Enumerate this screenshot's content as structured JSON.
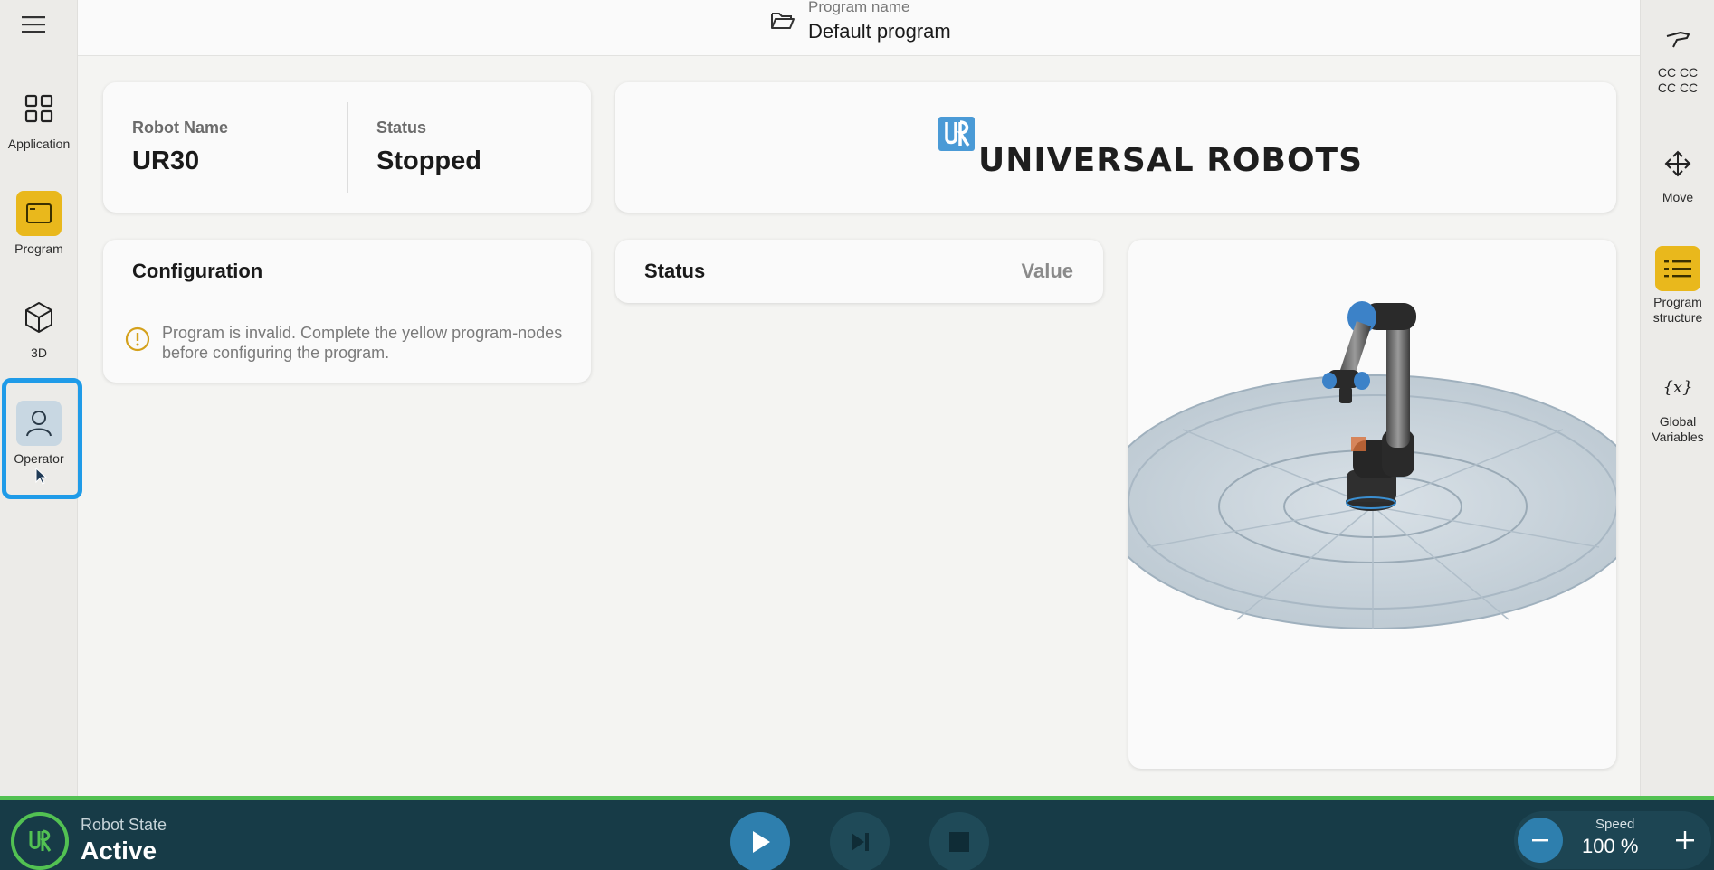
{
  "left_nav": {
    "items": [
      {
        "label": "Application",
        "icon": "grid-icon"
      },
      {
        "label": "Program",
        "icon": "program-window-icon"
      },
      {
        "label": "3D",
        "icon": "cube-icon"
      },
      {
        "label": "Operator",
        "icon": "person-icon"
      }
    ]
  },
  "right_nav": {
    "items": [
      {
        "label": "CC CC\nCC CC",
        "line1": "CC CC",
        "line2": "CC CC",
        "icon": "gripper-icon"
      },
      {
        "label": "Move",
        "line1": "Move",
        "line2": "",
        "icon": "move-arrows-icon"
      },
      {
        "label": "Program structure",
        "line1": "Program",
        "line2": "structure",
        "icon": "list-icon"
      },
      {
        "label": "Global Variables",
        "line1": "Global",
        "line2": "Variables",
        "icon": "variable-icon"
      }
    ]
  },
  "header": {
    "program_caption": "Program name",
    "program_value": "Default program"
  },
  "robot_info": {
    "name_label": "Robot Name",
    "name_value": "UR30",
    "status_label": "Status",
    "status_value": "Stopped"
  },
  "logo": {
    "text": "UNIVERSAL ROBOTS"
  },
  "configuration": {
    "title": "Configuration",
    "warning_line1": "Program is invalid. Complete the yellow program-nodes",
    "warning_line2": "before configuring the program."
  },
  "status_table": {
    "col_status": "Status",
    "col_value": "Value"
  },
  "bottom_bar": {
    "robot_state_caption": "Robot State",
    "robot_state_value": "Active",
    "speed_caption": "Speed",
    "speed_value": "100 %"
  },
  "colors": {
    "accent_yellow": "#e9b81c",
    "focus_blue": "#1f9be8",
    "bottom_bar": "#173b47",
    "active_green": "#52c152",
    "play_blue": "#2e7fae"
  }
}
